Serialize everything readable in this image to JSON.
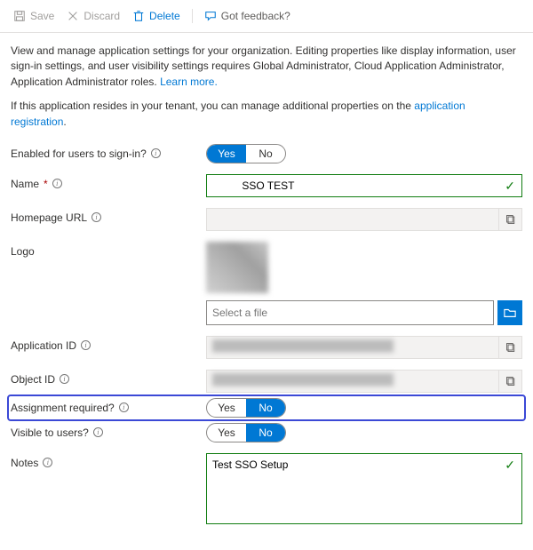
{
  "toolbar": {
    "save": "Save",
    "discard": "Discard",
    "delete": "Delete",
    "feedback": "Got feedback?"
  },
  "intro": {
    "text1": "View and manage application settings for your organization. Editing properties like display information, user sign-in settings, and user visibility settings requires Global Administrator, Cloud Application Administrator, Application Administrator roles. ",
    "learn": "Learn more.",
    "text2a": "If this application resides in your tenant, you can manage additional properties on the ",
    "regLink": "application registration",
    "text2b": "."
  },
  "labels": {
    "enabled": "Enabled for users to sign-in?",
    "name": "Name",
    "homepage": "Homepage URL",
    "logo": "Logo",
    "appId": "Application ID",
    "objectId": "Object ID",
    "assignment": "Assignment required?",
    "visible": "Visible to users?",
    "notes": "Notes"
  },
  "values": {
    "nameFull": "          SSO TEST",
    "filePlaceholder": "Select a file",
    "appIdMasked": "████████████████████████",
    "objectIdMasked": "████████████████████████",
    "notes": "Test SSO Setup"
  },
  "toggle": {
    "yes": "Yes",
    "no": "No"
  },
  "states": {
    "enabled": "yes",
    "assignment": "no",
    "visible": "no"
  }
}
